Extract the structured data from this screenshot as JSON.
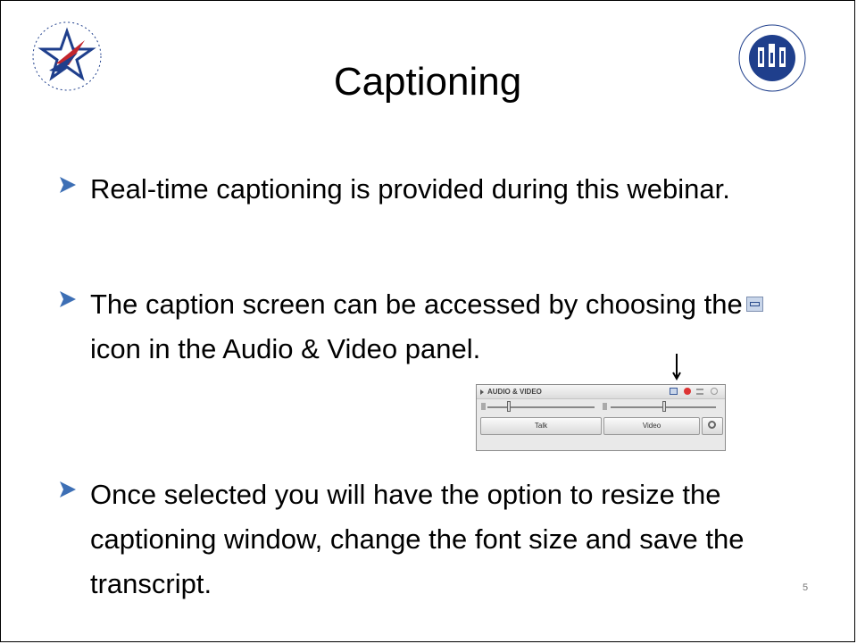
{
  "slide": {
    "title": "Captioning",
    "logos": {
      "left_alt": "UNITED STATES ACCESS BOARD",
      "right_alt": "ADA NATIONAL NETWORK"
    },
    "bullets": [
      {
        "text": "Real-time captioning is provided during this webinar."
      },
      {
        "before_icon": "The caption screen can be accessed by choosing the",
        "after_icon": "icon in the Audio & Video panel."
      },
      {
        "text": "Once selected you will have the option to resize the captioning window, change the font size and save the transcript."
      }
    ],
    "page_number": "5"
  },
  "panel": {
    "title": "AUDIO & VIDEO",
    "talk_label": "Talk",
    "video_label": "Video"
  },
  "icons": {
    "bullet": "bullet-arrow-icon",
    "caption": "closed-caption-icon",
    "down_arrow": "down-arrow-icon"
  },
  "colors": {
    "bullet_blue": "#3d6fb5",
    "text": "#000000",
    "logo_navy": "#1f3f8c",
    "logo_red": "#c3262d"
  }
}
